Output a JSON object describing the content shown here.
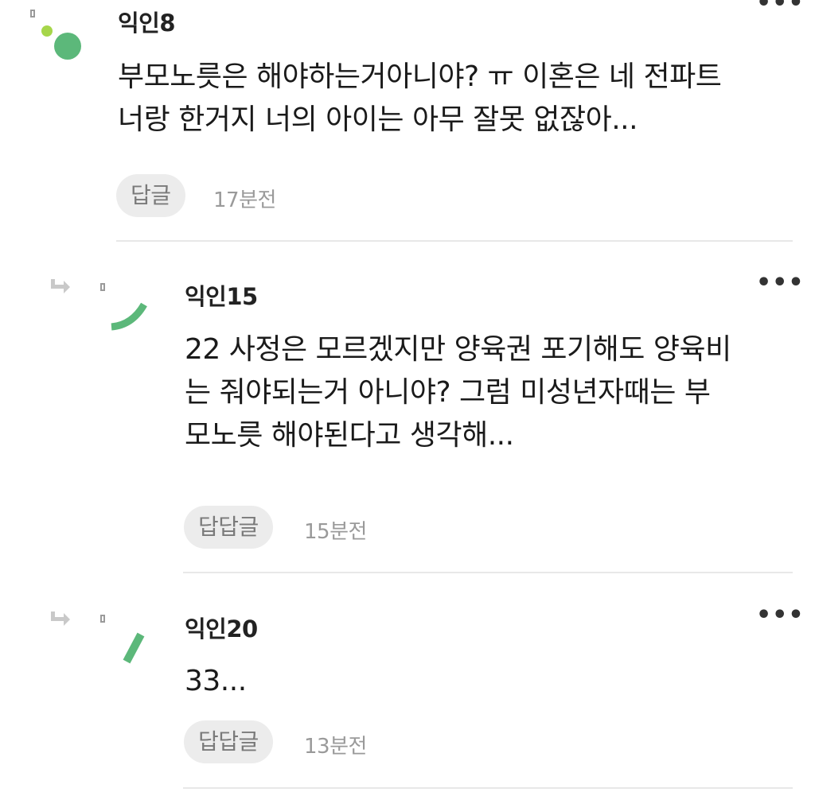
{
  "accent_color": "#5cb87a",
  "comments": [
    {
      "author": "익인8",
      "text": "부모노릇은 해야하는거아니야? ㅠ 이혼은 네 전파트\n너랑 한거지 너의 아이는 아무 잘못 없잖아...",
      "reply_label": "답글",
      "time": "17분전",
      "more_icon": "more-horizontal-icon",
      "more_glyph": "•••"
    },
    {
      "author": "익인15",
      "text": "22 사정은 모르겠지만 양육권 포기해도 양육비\n는 줘야되는거 아니야? 그럼 미성년자때는 부\n모노릇 해야된다고 생각해...",
      "reply_label": "답답글",
      "time": "15분전",
      "more_icon": "more-horizontal-icon",
      "more_glyph": "•••"
    },
    {
      "author": "익인20",
      "text": "33...",
      "reply_label": "답답글",
      "time": "13분전",
      "more_icon": "more-horizontal-icon",
      "more_glyph": "•••"
    }
  ]
}
